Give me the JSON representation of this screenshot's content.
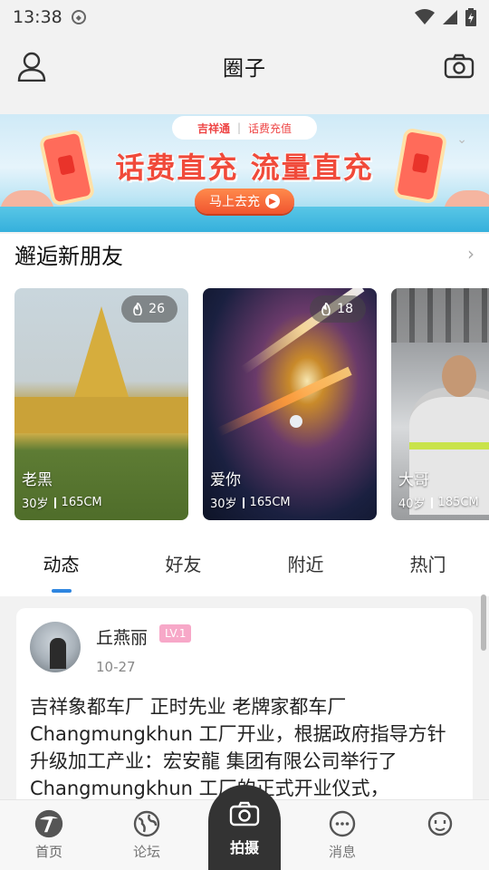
{
  "status": {
    "time": "13:38"
  },
  "header": {
    "title": "圈子"
  },
  "banner": {
    "brand": "吉祥通",
    "brand_sub": "话费充值",
    "headline": "话费直充  流量直充",
    "button": "马上去充"
  },
  "section": {
    "title": "邂逅新朋友",
    "more": "›"
  },
  "friends": [
    {
      "name": "老黑",
      "age": "30岁",
      "height": "165CM",
      "heat": "26"
    },
    {
      "name": "爱你",
      "age": "30岁",
      "height": "165CM",
      "heat": "18"
    },
    {
      "name": "大哥",
      "age": "40岁",
      "height": "185CM",
      "heat": ""
    }
  ],
  "tabs": [
    "动态",
    "好友",
    "附近",
    "热门"
  ],
  "post": {
    "user": "丘燕丽",
    "level": "LV.1",
    "date": "10-27",
    "body": "吉祥象都车厂 正时先业 老牌家都车厂 Changmungkhun 工厂开业，根据政府指导方针升级加工产业：宏安龍 集团有限公司举行了 Changmungkhun 工厂的正式开业仪式，"
  },
  "nav": {
    "home": "首页",
    "forum": "论坛",
    "camera": "拍摄",
    "messages": "消息",
    "profile": ""
  },
  "colors": {
    "accent": "#2f86e0",
    "banner_red": "#f04a3a",
    "level_pink": "#f7a8c8"
  }
}
